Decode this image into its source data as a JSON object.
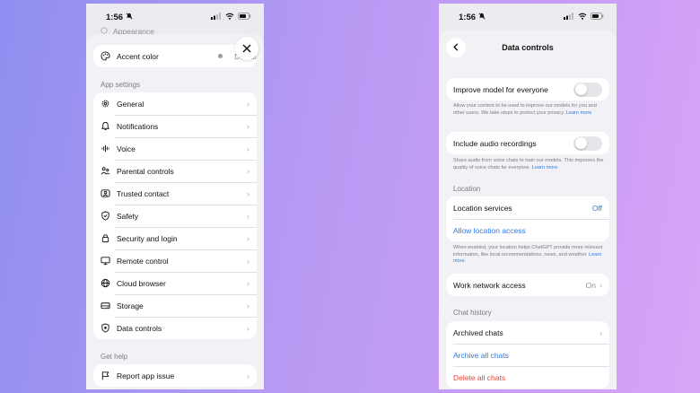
{
  "status": {
    "time": "1:56"
  },
  "left": {
    "peek_label": "Appearance",
    "accent": {
      "label": "Accent color",
      "value": "Default"
    },
    "app_settings_title": "App settings",
    "app_settings": [
      {
        "label": "General",
        "icon": "gear-icon"
      },
      {
        "label": "Notifications",
        "icon": "bell-icon"
      },
      {
        "label": "Voice",
        "icon": "waveform-icon"
      },
      {
        "label": "Parental controls",
        "icon": "family-icon"
      },
      {
        "label": "Trusted contact",
        "icon": "contact-card-icon"
      },
      {
        "label": "Safety",
        "icon": "shield-icon"
      },
      {
        "label": "Security and login",
        "icon": "lock-icon"
      },
      {
        "label": "Remote control",
        "icon": "monitor-icon"
      },
      {
        "label": "Cloud browser",
        "icon": "globe-icon"
      },
      {
        "label": "Storage",
        "icon": "drive-icon"
      },
      {
        "label": "Data controls",
        "icon": "data-shield-icon"
      }
    ],
    "get_help_title": "Get help",
    "help_items": [
      {
        "label": "Report app issue",
        "icon": "flag-icon"
      }
    ]
  },
  "right": {
    "title": "Data controls",
    "improve": {
      "label": "Improve model for everyone",
      "desc": "Allow your content to be used to improve our models for you and other users. We take steps to protect your privacy.",
      "link": "Learn more"
    },
    "audio": {
      "label": "Include audio recordings",
      "desc": "Share audio from voice chats to train our models. This improves the quality of voice chats for everyone.",
      "link": "Learn more"
    },
    "location_title": "Location",
    "location_services": {
      "label": "Location services",
      "value": "Off"
    },
    "allow_location": "Allow location access",
    "location_desc": "When enabled, your location helps ChatGPT provide more relevant information, like local recommendations, news, and weather.",
    "location_link": "Learn more",
    "work_network": {
      "label": "Work network access",
      "value": "On"
    },
    "chat_history_title": "Chat history",
    "archived_chats": "Archived chats",
    "archive_all": "Archive all chats",
    "delete_all": "Delete all chats"
  },
  "colors": {
    "link_blue": "#2c7be5",
    "danger_red": "#e5433a"
  }
}
